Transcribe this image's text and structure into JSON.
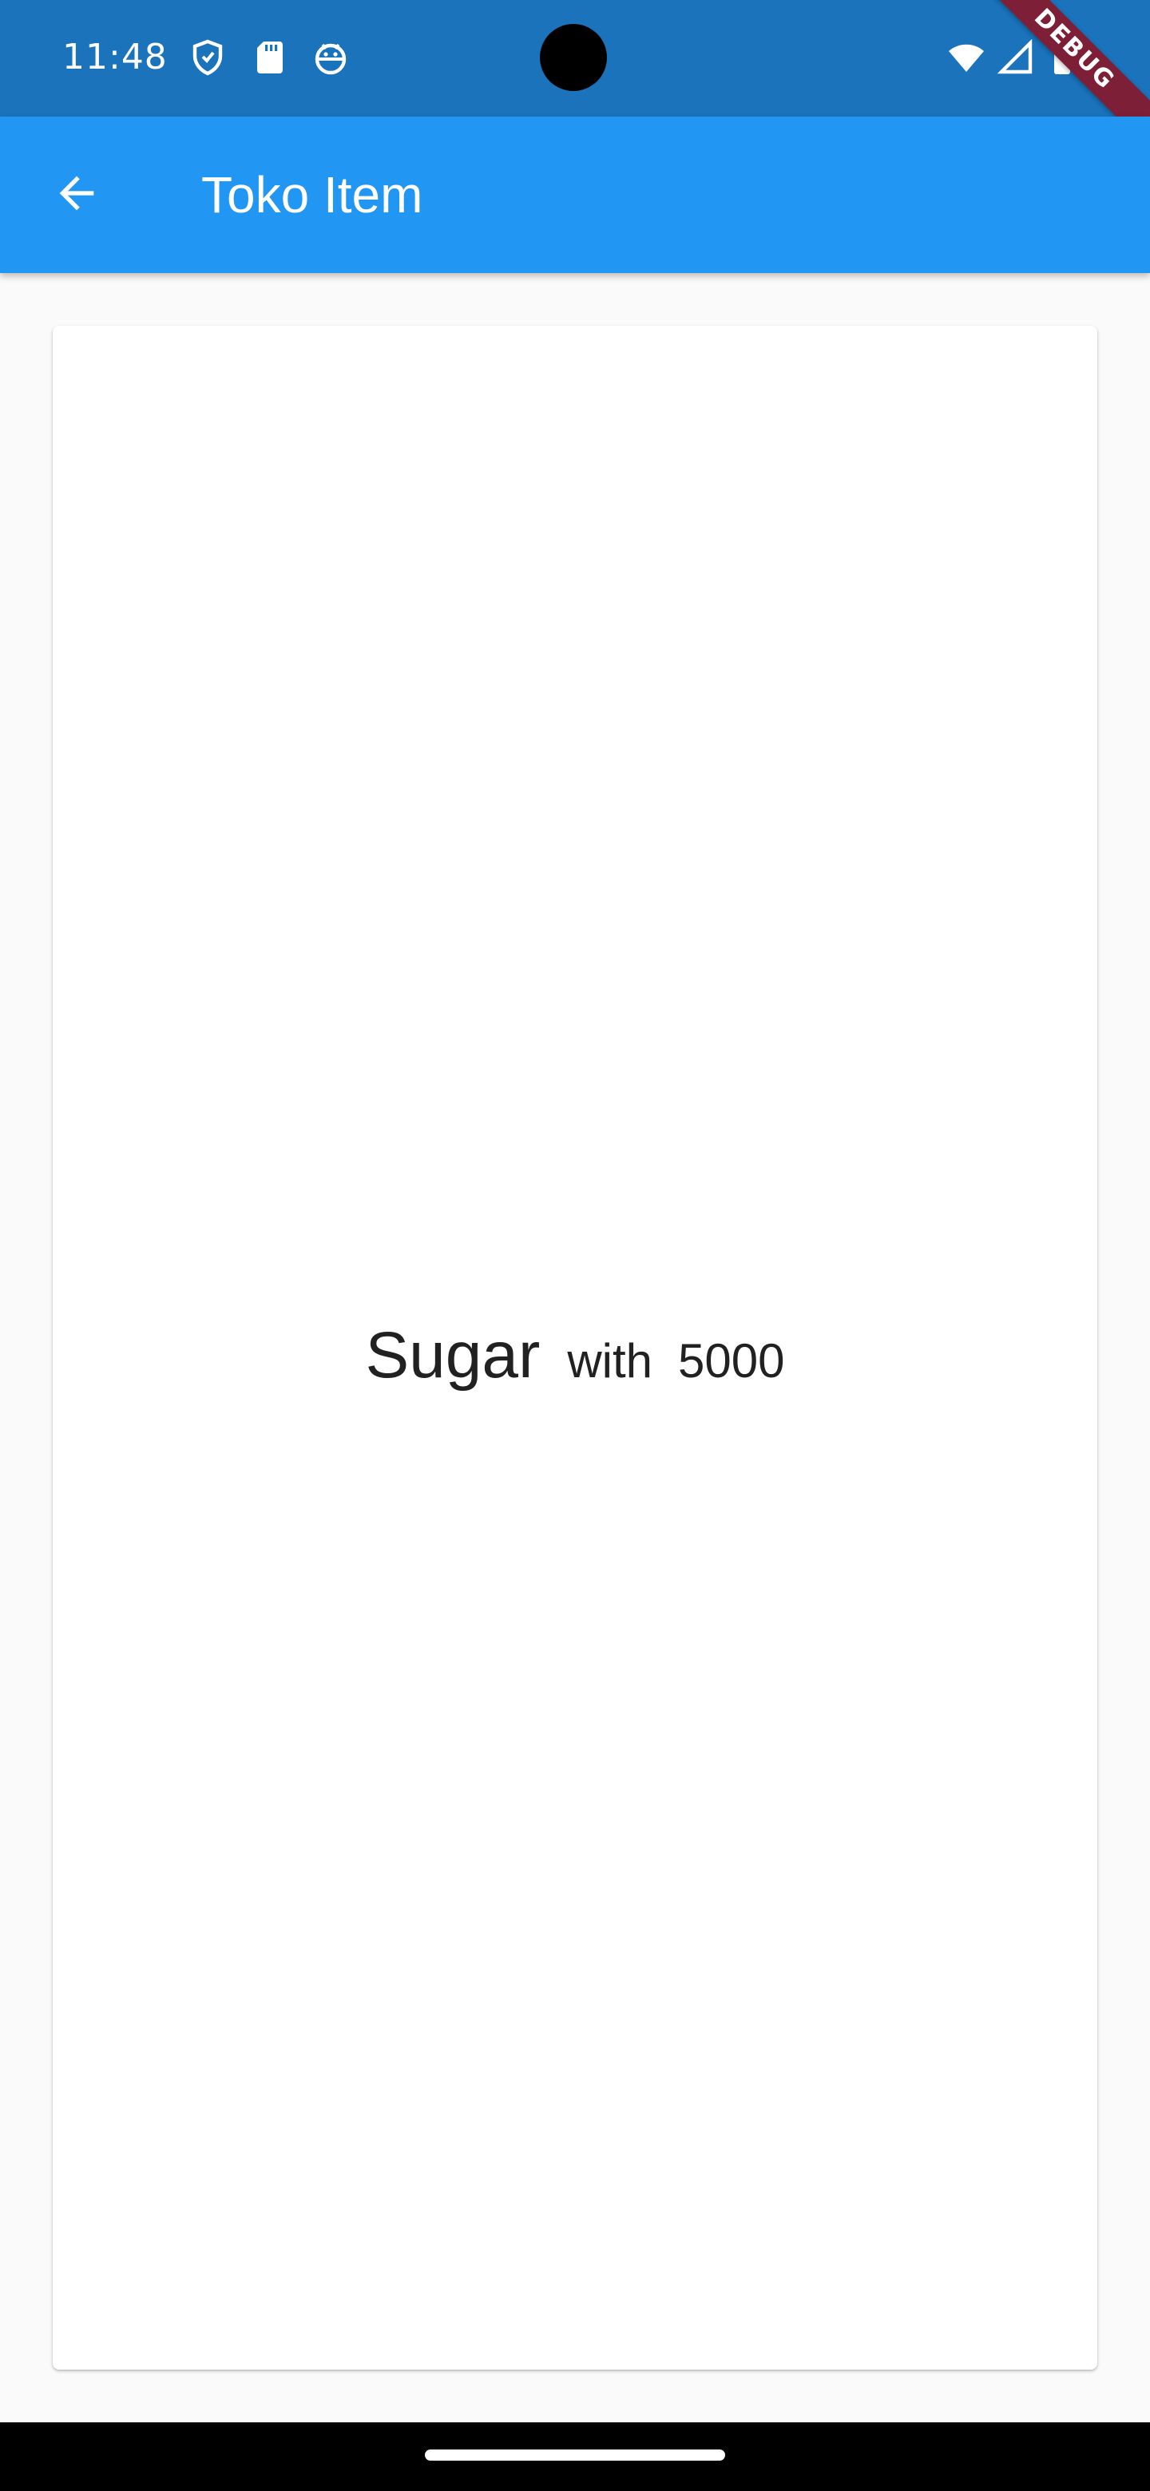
{
  "status_bar": {
    "time": "11:48",
    "left_icons": [
      "shield-icon",
      "sd-card-icon",
      "android-icon"
    ],
    "right_icons": [
      "wifi-icon",
      "signal-icon",
      "battery-icon"
    ],
    "debug_label": "DEBUG"
  },
  "app_bar": {
    "title": "Toko Item",
    "back_icon": "arrow-back-icon",
    "color": "#2196f3"
  },
  "item": {
    "name": "Sugar",
    "connector": "with",
    "price": "5000"
  },
  "colors": {
    "status_bar": "#1a73bb",
    "background": "#fafafa",
    "card": "#ffffff",
    "text": "#212121"
  }
}
